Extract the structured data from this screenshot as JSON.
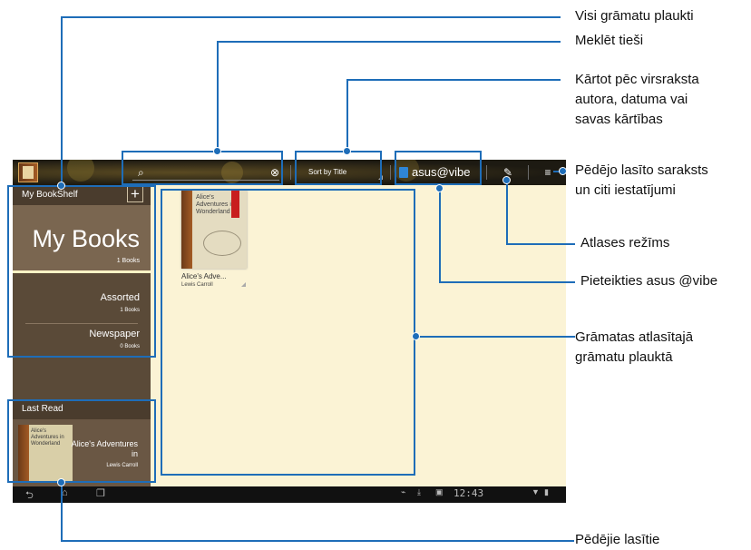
{
  "topbar": {
    "sort_label": "Sort by Title",
    "vibe_label": "asus@vibe",
    "icons": [
      "app-icon",
      "search-icon",
      "clear-icon",
      "edit-pencil-icon",
      "menu-icon"
    ]
  },
  "sidebar": {
    "header": "My BookShelf",
    "add_icon": "+",
    "mybooks_title": "My Books",
    "mybooks_count": "1 Books",
    "items": [
      {
        "name": "Assorted",
        "count": "1 Books"
      },
      {
        "name": "Newspaper",
        "count": "0 Books"
      }
    ],
    "last_read_header": "Last Read",
    "last_read": {
      "cover_title": "Alice's Adventures in Wonderland",
      "title": "Alice's Adventures in",
      "author": "Lewis Carroll"
    }
  },
  "main": {
    "book": {
      "cover_title": "Alice's Adventures in Wonderland",
      "title": "Alice's Adve...",
      "author": "Lewis Carroll"
    }
  },
  "navbar": {
    "clock": "12:43",
    "icons": [
      "back-icon",
      "home-icon",
      "recent-apps-icon"
    ]
  },
  "callouts": {
    "all_shelves": "Visi grāmatu plaukti",
    "search": "Meklēt tieši",
    "sort_line1": "Kārtot pēc virsraksta",
    "sort_line2": "autora, datuma vai",
    "sort_line3": "savas kārtības",
    "lastread_list_line1": "Pēdējo lasīto saraksts",
    "lastread_list_line2": "un citi iestatījumi",
    "selection_mode": "Atlases režīms",
    "vibe_login": "Pieteikties asus @vibe",
    "books_line1": "Grāmatas atlasītajā",
    "books_line2": "grāmatu plauktā",
    "recently_read": "Pēdējie lasītie"
  },
  "colors": {
    "callout": "#1e6db8",
    "panel": "#fbf3d5",
    "sidebar": "#5a4a38"
  }
}
